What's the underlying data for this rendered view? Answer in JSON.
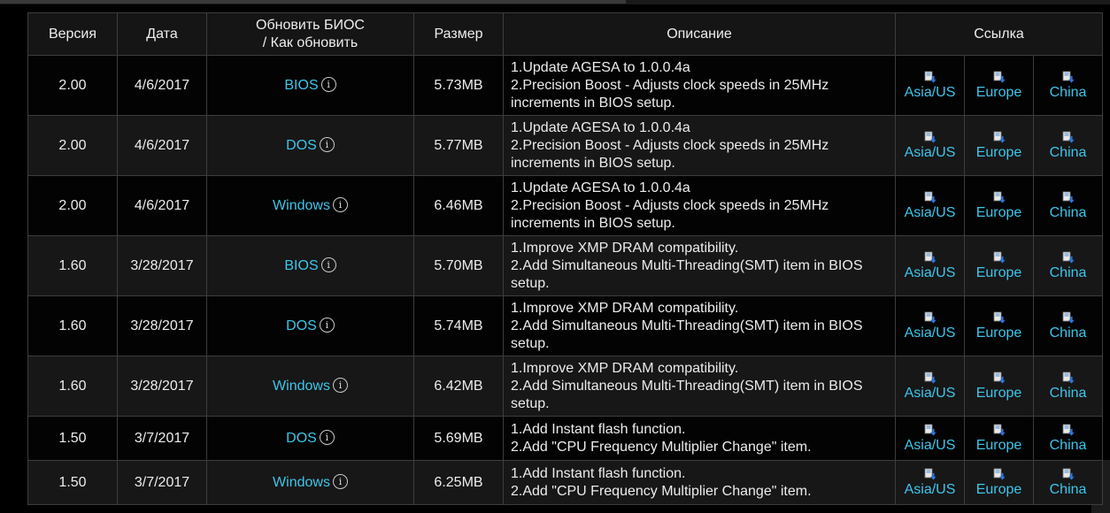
{
  "table": {
    "headers": {
      "version": "Версия",
      "date": "Дата",
      "update_line1": "Обновить БИОС",
      "update_line2": "/ Как обновить",
      "size": "Размер",
      "description": "Описание",
      "link": "Ссылка"
    },
    "rows": [
      {
        "version": "2.00",
        "date": "4/6/2017",
        "method": "BIOS",
        "size": "5.73MB",
        "desc": [
          "1.Update AGESA to 1.0.0.4a",
          "2.Precision Boost - Adjusts clock speeds in 25MHz",
          "increments in BIOS setup."
        ],
        "links": [
          "Asia/US",
          "Europe",
          "China"
        ]
      },
      {
        "version": "2.00",
        "date": "4/6/2017",
        "method": "DOS",
        "size": "5.77MB",
        "desc": [
          "1.Update AGESA to 1.0.0.4a",
          "2.Precision Boost - Adjusts clock speeds in 25MHz",
          "increments in BIOS setup."
        ],
        "links": [
          "Asia/US",
          "Europe",
          "China"
        ]
      },
      {
        "version": "2.00",
        "date": "4/6/2017",
        "method": "Windows",
        "size": "6.46MB",
        "desc": [
          "1.Update AGESA to 1.0.0.4a",
          "2.Precision Boost - Adjusts clock speeds in 25MHz",
          "increments in BIOS setup."
        ],
        "links": [
          "Asia/US",
          "Europe",
          "China"
        ]
      },
      {
        "version": "1.60",
        "date": "3/28/2017",
        "method": "BIOS",
        "size": "5.70MB",
        "desc": [
          "1.Improve XMP DRAM compatibility.",
          "2.Add Simultaneous Multi-Threading(SMT) item in BIOS",
          "setup."
        ],
        "links": [
          "Asia/US",
          "Europe",
          "China"
        ]
      },
      {
        "version": "1.60",
        "date": "3/28/2017",
        "method": "DOS",
        "size": "5.74MB",
        "desc": [
          "1.Improve XMP DRAM compatibility.",
          "2.Add Simultaneous Multi-Threading(SMT) item in BIOS",
          "setup."
        ],
        "links": [
          "Asia/US",
          "Europe",
          "China"
        ]
      },
      {
        "version": "1.60",
        "date": "3/28/2017",
        "method": "Windows",
        "size": "6.42MB",
        "desc": [
          "1.Improve XMP DRAM compatibility.",
          "2.Add Simultaneous Multi-Threading(SMT) item in BIOS",
          "setup."
        ],
        "links": [
          "Asia/US",
          "Europe",
          "China"
        ]
      },
      {
        "version": "1.50",
        "date": "3/7/2017",
        "method": "DOS",
        "size": "5.69MB",
        "desc": [
          "1.Add Instant flash function.",
          "2.Add \"CPU Frequency Multiplier Change\" item."
        ],
        "links": [
          "Asia/US",
          "Europe",
          "China"
        ]
      },
      {
        "version": "1.50",
        "date": "3/7/2017",
        "method": "Windows",
        "size": "6.25MB",
        "desc": [
          "1.Add Instant flash function.",
          "2.Add \"CPU Frequency Multiplier Change\" item."
        ],
        "links": [
          "Asia/US",
          "Europe",
          "China"
        ]
      }
    ]
  },
  "icons": {
    "info": "info-circle-icon",
    "download": "download-icon"
  },
  "colors": {
    "background": "#000000",
    "link": "#3ec5ea",
    "text": "#ececec",
    "border": "#3d3d3d"
  }
}
